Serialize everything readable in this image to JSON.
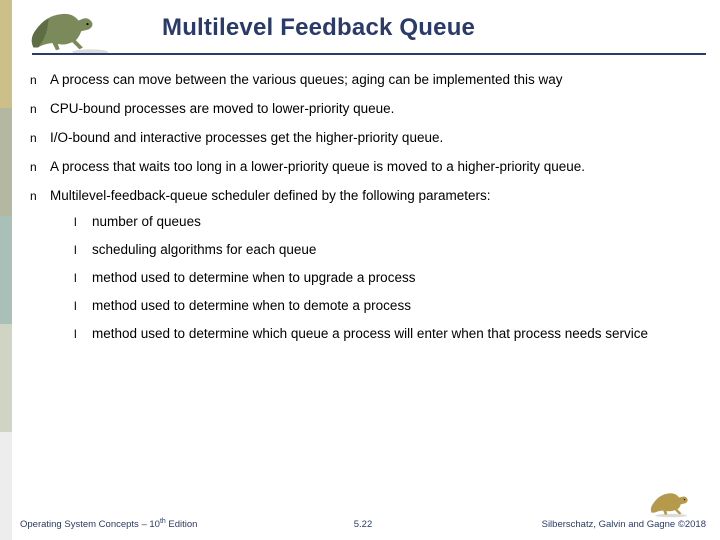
{
  "title": "Multilevel Feedback Queue",
  "bullets": [
    {
      "text": "A process can move between the various queues; aging can be implemented this way"
    },
    {
      "text": "CPU-bound processes are moved to lower-priority queue."
    },
    {
      "text": "I/O-bound and interactive processes get the higher-priority queue."
    },
    {
      "text": "A process that waits too long in a lower-priority queue is moved to a higher-priority queue."
    },
    {
      "text": "Multilevel-feedback-queue scheduler defined by the following parameters:",
      "sub": [
        "number of queues",
        "scheduling algorithms for each queue",
        "method used to determine when to upgrade a process",
        "method used to determine when to demote a process",
        "method used to determine which queue a process will enter when that process needs service"
      ]
    }
  ],
  "marker1": "n",
  "marker2": "l",
  "footer": {
    "left_a": "Operating System Concepts – 10",
    "left_sup": "th",
    "left_b": " Edition",
    "center": "5.22",
    "right": "Silberschatz, Galvin and Gagne ©2018"
  }
}
